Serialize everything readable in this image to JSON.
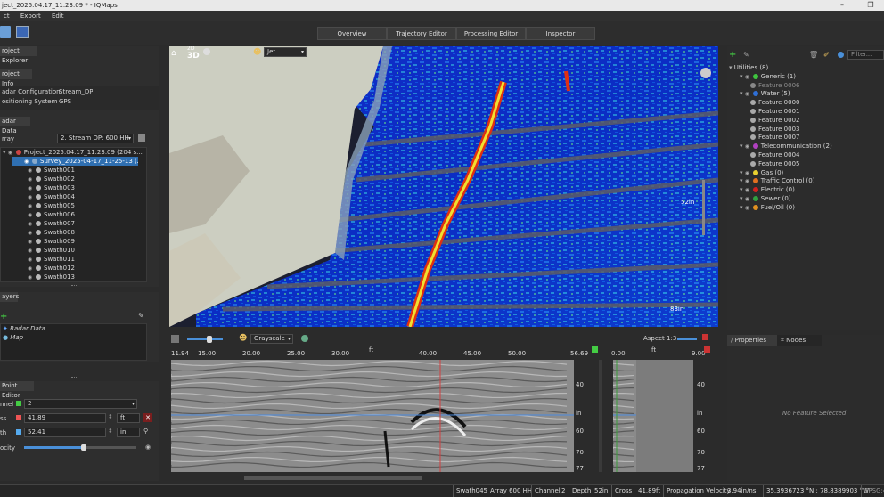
{
  "window": {
    "title": "ject_2025.04.17_11.23.09 * - IQMaps"
  },
  "menu": [
    "ct",
    "Export",
    "Edit"
  ],
  "tabs": [
    "Overview",
    "Trajectory Editor",
    "Processing Editor",
    "Inspector"
  ],
  "explorer": {
    "title": "roject Explorer",
    "project_info_hdr": "roject Info",
    "info": [
      {
        "label": "adar Configuration",
        "value": "Stream_DP"
      },
      {
        "label": "ositioning System",
        "value": "GPS"
      }
    ],
    "radar_data_hdr": "adar Data",
    "array_label": "rray",
    "array_value": "2. Stream DP: 600 HH",
    "tree": {
      "project": "Project_2025.04.17_11.23.09 (204 s...",
      "survey": "Survey_2025-04-17_11-25-13 (2...",
      "swaths": [
        "Swath001",
        "Swath002",
        "Swath003",
        "Swath004",
        "Swath005",
        "Swath006",
        "Swath007",
        "Swath008",
        "Swath009",
        "Swath010",
        "Swath011",
        "Swath012",
        "Swath013"
      ]
    }
  },
  "layers": {
    "title": "ayers",
    "items": [
      "Radar Data",
      "Map"
    ]
  },
  "point_editor": {
    "title": "Point Editor",
    "channel_label": "nnel",
    "channel_value": "2",
    "cross_label": "ss",
    "cross_value": "41.89",
    "cross_unit": "ft",
    "depth_label": "th",
    "depth_value": "52.41",
    "depth_unit": "in",
    "velocity_label": "ocity"
  },
  "map": {
    "colormap": "Jet",
    "mode2d": "2D",
    "mode3d": "3D",
    "depth_readout": "52in",
    "scale_readout": "83in"
  },
  "radargram": {
    "colormap": "Grayscale",
    "aspect_label": "Aspect 1:3",
    "ticks": [
      "11.94",
      "15.00",
      "20.00",
      "25.00",
      "30.00",
      "ft",
      "40.00",
      "45.00",
      "50.00",
      "56.69"
    ],
    "depth_ticks": [
      "40",
      "in",
      "60",
      "70",
      "77"
    ],
    "side_ticks_left": "0.00",
    "side_ticks_unit": "ft",
    "side_ticks_right": "9.00"
  },
  "utilities": {
    "filter_placeholder": "Filter...",
    "items": [
      {
        "label": "Utilities (8)",
        "color": "#cccccc",
        "level": 0
      },
      {
        "label": "Generic (1)",
        "color": "#3ec43e",
        "level": 1
      },
      {
        "label": "Feature 0006",
        "color": "#888888",
        "level": 2,
        "dim": true
      },
      {
        "label": "Water (5)",
        "color": "#2f6fd6",
        "level": 1
      },
      {
        "label": "Feature 0000",
        "color": "#aaaaaa",
        "level": 2
      },
      {
        "label": "Feature 0001",
        "color": "#aaaaaa",
        "level": 2
      },
      {
        "label": "Feature 0002",
        "color": "#aaaaaa",
        "level": 2
      },
      {
        "label": "Feature 0003",
        "color": "#aaaaaa",
        "level": 2
      },
      {
        "label": "Feature 0007",
        "color": "#aaaaaa",
        "level": 2
      },
      {
        "label": "Telecommunication (2)",
        "color": "#b040c0",
        "level": 1
      },
      {
        "label": "Feature 0004",
        "color": "#aaaaaa",
        "level": 2
      },
      {
        "label": "Feature 0005",
        "color": "#aaaaaa",
        "level": 2
      },
      {
        "label": "Gas (0)",
        "color": "#e8d030",
        "level": 1
      },
      {
        "label": "Traffic Control (0)",
        "color": "#e07020",
        "level": 1
      },
      {
        "label": "Electric (0)",
        "color": "#d02020",
        "level": 1
      },
      {
        "label": "Sewer (0)",
        "color": "#30a040",
        "level": 1
      },
      {
        "label": "Fuel/Oil (0)",
        "color": "#e09020",
        "level": 1
      }
    ]
  },
  "properties": {
    "tabs": [
      "Properties",
      "Nodes"
    ],
    "empty": "No Feature Selected"
  },
  "status": [
    "Swath045",
    "Array 600 HH",
    "Channel",
    "2",
    "Depth",
    "52in",
    "Cross",
    "41.89ft",
    "Propagation Velocity",
    "3.94in/ns",
    "35.3936723 °N : 78.8389903 °W",
    "EPSG:4"
  ]
}
